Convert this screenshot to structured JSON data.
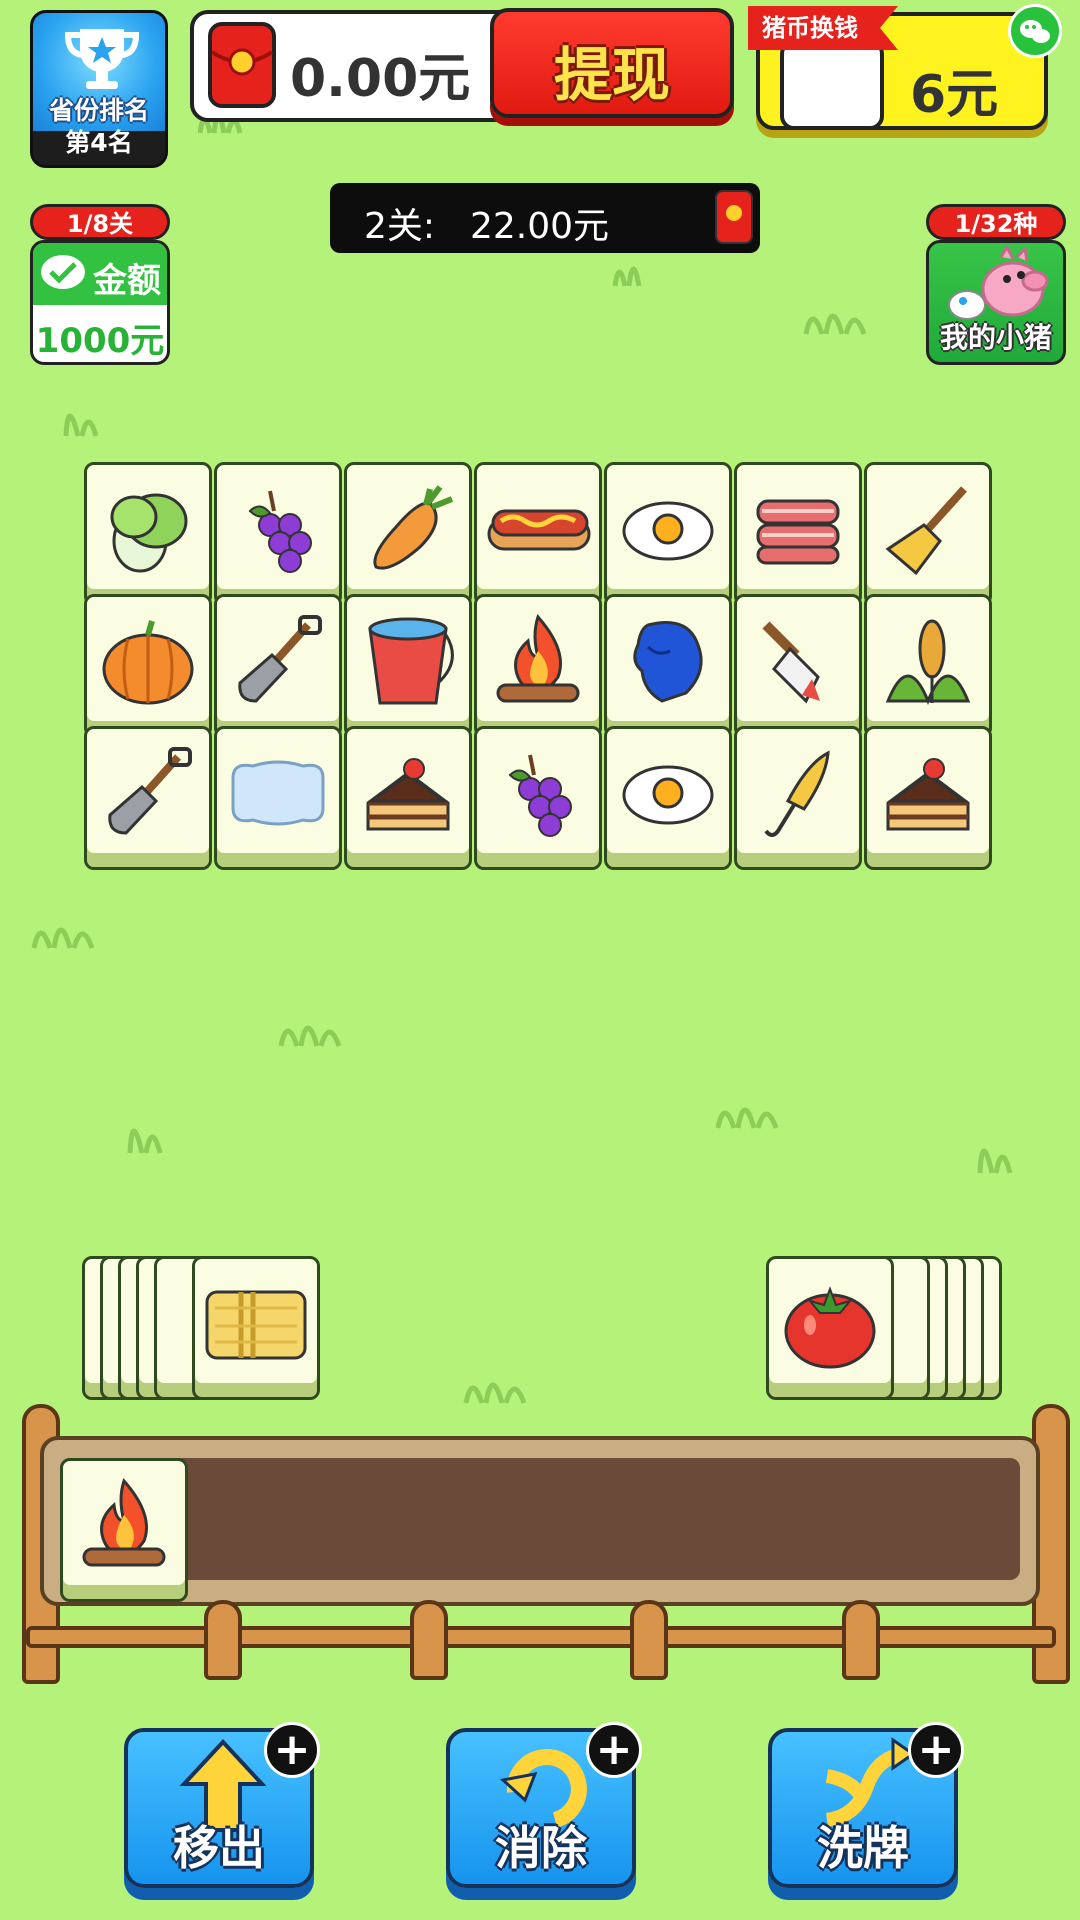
{
  "ranking": {
    "label": "省份排名",
    "value": "第4名"
  },
  "wallet": {
    "amount": "0.00元",
    "withdraw_label": "提现"
  },
  "exchange": {
    "flag": "猪币换钱",
    "amount": "6元"
  },
  "level": {
    "label": "2关:",
    "amount": "22.00元"
  },
  "wechat_card": {
    "badge": "1/8关",
    "title": "金额",
    "value": "1000元"
  },
  "pig_card": {
    "badge": "1/32种",
    "label": "我的小猪"
  },
  "board": {
    "rows": [
      [
        "lettuce",
        "grapes",
        "carrot",
        "hotdog",
        "egg",
        "bacon",
        "broom"
      ],
      [
        "pumpkin",
        "shovel",
        "bucket",
        "campfire",
        "glove",
        "brush",
        "wheat"
      ],
      [
        "shovel",
        "soap",
        "cake",
        "grapes",
        "egg",
        "umbrella",
        "cake"
      ]
    ]
  },
  "left_stack": {
    "top_item": "haybale"
  },
  "right_stack": {
    "top_item": "tomato"
  },
  "tray": {
    "items": [
      "campfire"
    ]
  },
  "actions": [
    {
      "label": "移出",
      "icon": "arrow-up-icon"
    },
    {
      "label": "消除",
      "icon": "refresh-icon"
    },
    {
      "label": "洗牌",
      "icon": "shuffle-icon"
    }
  ],
  "colors": {
    "background": "#b5f27a",
    "withdraw": "#e11a10",
    "exchange": "#fff31f",
    "action": "#1694ee"
  }
}
